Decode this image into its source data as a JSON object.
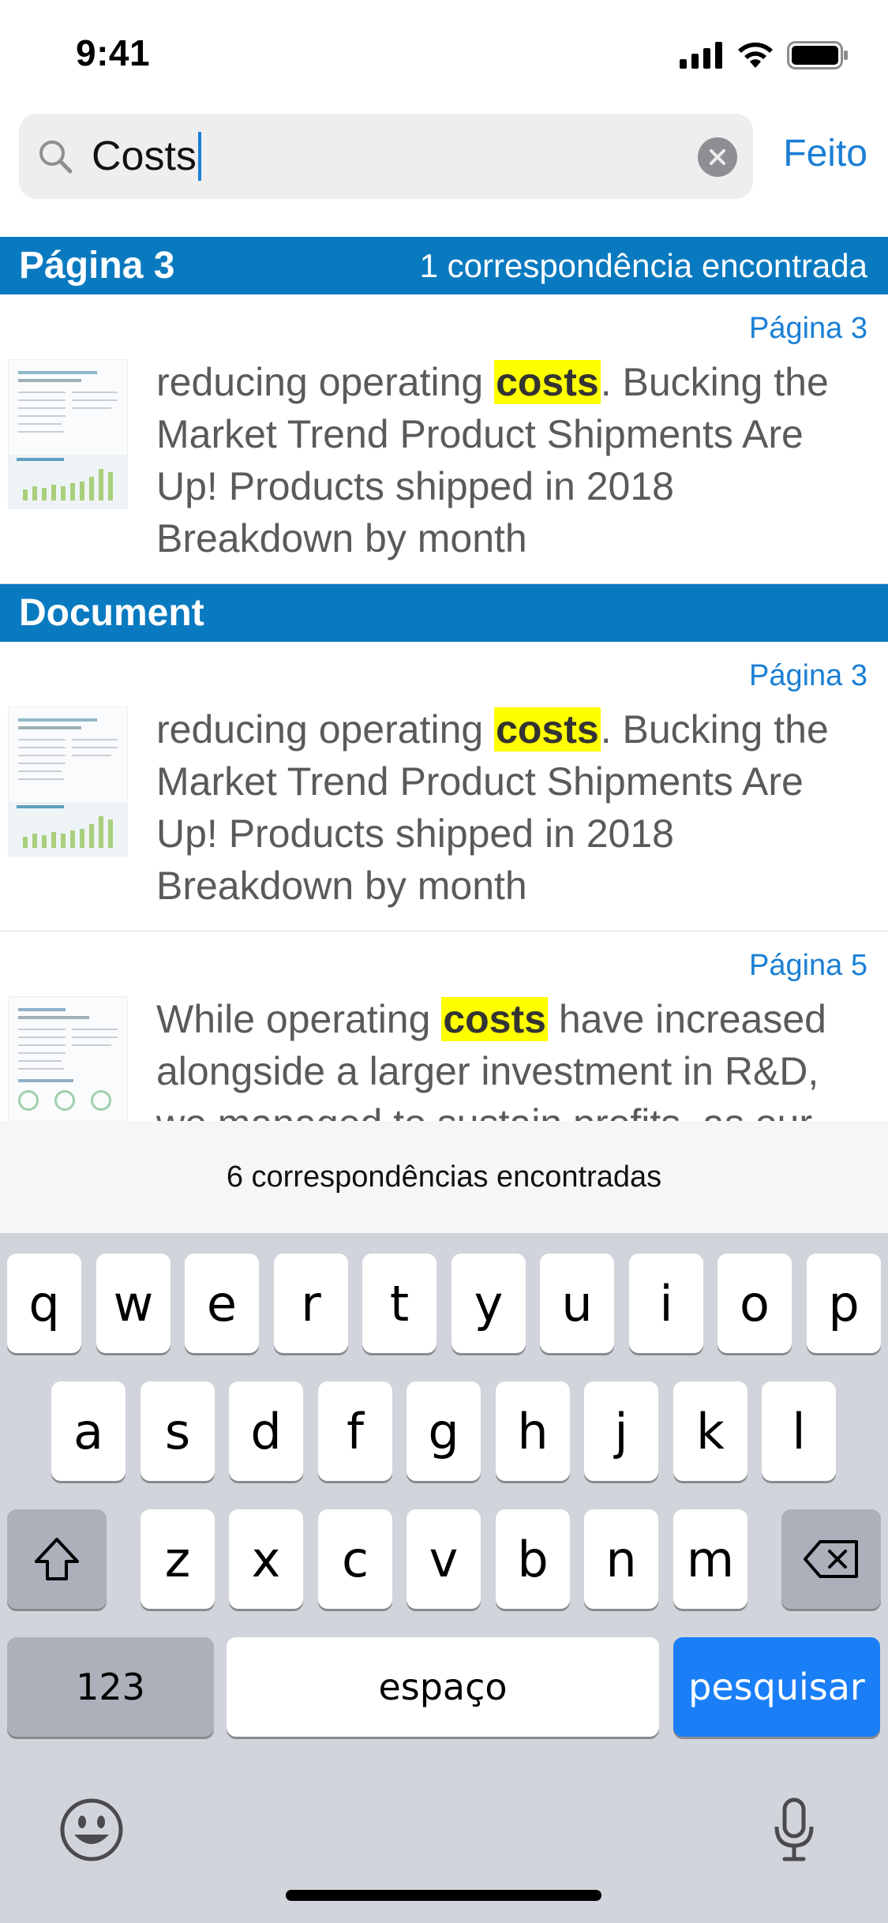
{
  "status_bar": {
    "time": "9:41"
  },
  "search": {
    "query": "Costs",
    "done_label": "Feito"
  },
  "sections": [
    {
      "title": "Página 3",
      "count": "1 correspondência encontrada",
      "results": [
        {
          "page": "Página 3",
          "before": "reducing operating ",
          "match": "costs",
          "after": ". Bucking the Market Trend Product Shipments Are Up! Products shipped in 2018 Breakdown by month"
        }
      ]
    },
    {
      "title": "Document",
      "results": [
        {
          "page": "Página 3",
          "before": "reducing operating ",
          "match": "costs",
          "after": ". Bucking the Market Trend Product Shipments Are Up! Products shipped in 2018 Breakdown by month"
        },
        {
          "page": "Página 5",
          "before": "While operating ",
          "match": "costs",
          "after": " have increased alongside a larger investment in R&D, we managed to sustain profits, as our"
        }
      ]
    }
  ],
  "match_summary": "6 correspondências encontradas",
  "keyboard": {
    "row1": [
      "q",
      "w",
      "e",
      "r",
      "t",
      "y",
      "u",
      "i",
      "o",
      "p"
    ],
    "row2": [
      "a",
      "s",
      "d",
      "f",
      "g",
      "h",
      "j",
      "k",
      "l"
    ],
    "row3": [
      "z",
      "x",
      "c",
      "v",
      "b",
      "n",
      "m"
    ],
    "numbers_label": "123",
    "space_label": "espaço",
    "search_label": "pesquisar",
    "shift_icon": "shift-arrow-icon",
    "delete_icon": "backspace-icon",
    "emoji_icon": "emoji-icon",
    "mic_icon": "microphone-icon"
  },
  "colors": {
    "accent": "#1a7fd4",
    "section_header": "#0a7ac0",
    "highlight": "#ffff00",
    "search_key": "#1a7ff7"
  }
}
